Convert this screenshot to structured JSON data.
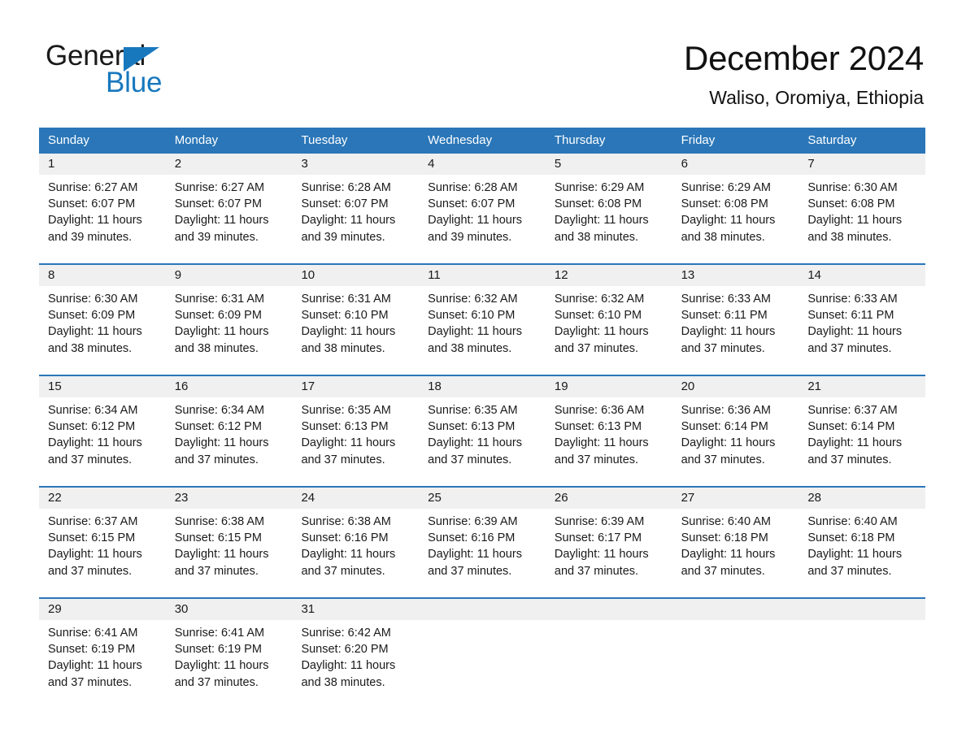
{
  "brand": {
    "name_part1": "General",
    "name_part2": "Blue",
    "accent_color": "#1878be",
    "header_color": "#2a76b8"
  },
  "header": {
    "title": "December 2024",
    "subtitle": "Waliso, Oromiya, Ethiopia"
  },
  "weekdays": [
    "Sunday",
    "Monday",
    "Tuesday",
    "Wednesday",
    "Thursday",
    "Friday",
    "Saturday"
  ],
  "weeks": [
    [
      {
        "day": "1",
        "sunrise": "Sunrise: 6:27 AM",
        "sunset": "Sunset: 6:07 PM",
        "daylight": "Daylight: 11 hours and 39 minutes."
      },
      {
        "day": "2",
        "sunrise": "Sunrise: 6:27 AM",
        "sunset": "Sunset: 6:07 PM",
        "daylight": "Daylight: 11 hours and 39 minutes."
      },
      {
        "day": "3",
        "sunrise": "Sunrise: 6:28 AM",
        "sunset": "Sunset: 6:07 PM",
        "daylight": "Daylight: 11 hours and 39 minutes."
      },
      {
        "day": "4",
        "sunrise": "Sunrise: 6:28 AM",
        "sunset": "Sunset: 6:07 PM",
        "daylight": "Daylight: 11 hours and 39 minutes."
      },
      {
        "day": "5",
        "sunrise": "Sunrise: 6:29 AM",
        "sunset": "Sunset: 6:08 PM",
        "daylight": "Daylight: 11 hours and 38 minutes."
      },
      {
        "day": "6",
        "sunrise": "Sunrise: 6:29 AM",
        "sunset": "Sunset: 6:08 PM",
        "daylight": "Daylight: 11 hours and 38 minutes."
      },
      {
        "day": "7",
        "sunrise": "Sunrise: 6:30 AM",
        "sunset": "Sunset: 6:08 PM",
        "daylight": "Daylight: 11 hours and 38 minutes."
      }
    ],
    [
      {
        "day": "8",
        "sunrise": "Sunrise: 6:30 AM",
        "sunset": "Sunset: 6:09 PM",
        "daylight": "Daylight: 11 hours and 38 minutes."
      },
      {
        "day": "9",
        "sunrise": "Sunrise: 6:31 AM",
        "sunset": "Sunset: 6:09 PM",
        "daylight": "Daylight: 11 hours and 38 minutes."
      },
      {
        "day": "10",
        "sunrise": "Sunrise: 6:31 AM",
        "sunset": "Sunset: 6:10 PM",
        "daylight": "Daylight: 11 hours and 38 minutes."
      },
      {
        "day": "11",
        "sunrise": "Sunrise: 6:32 AM",
        "sunset": "Sunset: 6:10 PM",
        "daylight": "Daylight: 11 hours and 38 minutes."
      },
      {
        "day": "12",
        "sunrise": "Sunrise: 6:32 AM",
        "sunset": "Sunset: 6:10 PM",
        "daylight": "Daylight: 11 hours and 37 minutes."
      },
      {
        "day": "13",
        "sunrise": "Sunrise: 6:33 AM",
        "sunset": "Sunset: 6:11 PM",
        "daylight": "Daylight: 11 hours and 37 minutes."
      },
      {
        "day": "14",
        "sunrise": "Sunrise: 6:33 AM",
        "sunset": "Sunset: 6:11 PM",
        "daylight": "Daylight: 11 hours and 37 minutes."
      }
    ],
    [
      {
        "day": "15",
        "sunrise": "Sunrise: 6:34 AM",
        "sunset": "Sunset: 6:12 PM",
        "daylight": "Daylight: 11 hours and 37 minutes."
      },
      {
        "day": "16",
        "sunrise": "Sunrise: 6:34 AM",
        "sunset": "Sunset: 6:12 PM",
        "daylight": "Daylight: 11 hours and 37 minutes."
      },
      {
        "day": "17",
        "sunrise": "Sunrise: 6:35 AM",
        "sunset": "Sunset: 6:13 PM",
        "daylight": "Daylight: 11 hours and 37 minutes."
      },
      {
        "day": "18",
        "sunrise": "Sunrise: 6:35 AM",
        "sunset": "Sunset: 6:13 PM",
        "daylight": "Daylight: 11 hours and 37 minutes."
      },
      {
        "day": "19",
        "sunrise": "Sunrise: 6:36 AM",
        "sunset": "Sunset: 6:13 PM",
        "daylight": "Daylight: 11 hours and 37 minutes."
      },
      {
        "day": "20",
        "sunrise": "Sunrise: 6:36 AM",
        "sunset": "Sunset: 6:14 PM",
        "daylight": "Daylight: 11 hours and 37 minutes."
      },
      {
        "day": "21",
        "sunrise": "Sunrise: 6:37 AM",
        "sunset": "Sunset: 6:14 PM",
        "daylight": "Daylight: 11 hours and 37 minutes."
      }
    ],
    [
      {
        "day": "22",
        "sunrise": "Sunrise: 6:37 AM",
        "sunset": "Sunset: 6:15 PM",
        "daylight": "Daylight: 11 hours and 37 minutes."
      },
      {
        "day": "23",
        "sunrise": "Sunrise: 6:38 AM",
        "sunset": "Sunset: 6:15 PM",
        "daylight": "Daylight: 11 hours and 37 minutes."
      },
      {
        "day": "24",
        "sunrise": "Sunrise: 6:38 AM",
        "sunset": "Sunset: 6:16 PM",
        "daylight": "Daylight: 11 hours and 37 minutes."
      },
      {
        "day": "25",
        "sunrise": "Sunrise: 6:39 AM",
        "sunset": "Sunset: 6:16 PM",
        "daylight": "Daylight: 11 hours and 37 minutes."
      },
      {
        "day": "26",
        "sunrise": "Sunrise: 6:39 AM",
        "sunset": "Sunset: 6:17 PM",
        "daylight": "Daylight: 11 hours and 37 minutes."
      },
      {
        "day": "27",
        "sunrise": "Sunrise: 6:40 AM",
        "sunset": "Sunset: 6:18 PM",
        "daylight": "Daylight: 11 hours and 37 minutes."
      },
      {
        "day": "28",
        "sunrise": "Sunrise: 6:40 AM",
        "sunset": "Sunset: 6:18 PM",
        "daylight": "Daylight: 11 hours and 37 minutes."
      }
    ],
    [
      {
        "day": "29",
        "sunrise": "Sunrise: 6:41 AM",
        "sunset": "Sunset: 6:19 PM",
        "daylight": "Daylight: 11 hours and 37 minutes."
      },
      {
        "day": "30",
        "sunrise": "Sunrise: 6:41 AM",
        "sunset": "Sunset: 6:19 PM",
        "daylight": "Daylight: 11 hours and 37 minutes."
      },
      {
        "day": "31",
        "sunrise": "Sunrise: 6:42 AM",
        "sunset": "Sunset: 6:20 PM",
        "daylight": "Daylight: 11 hours and 38 minutes."
      },
      {
        "day": "",
        "sunrise": "",
        "sunset": "",
        "daylight": ""
      },
      {
        "day": "",
        "sunrise": "",
        "sunset": "",
        "daylight": ""
      },
      {
        "day": "",
        "sunrise": "",
        "sunset": "",
        "daylight": ""
      },
      {
        "day": "",
        "sunrise": "",
        "sunset": "",
        "daylight": ""
      }
    ]
  ]
}
